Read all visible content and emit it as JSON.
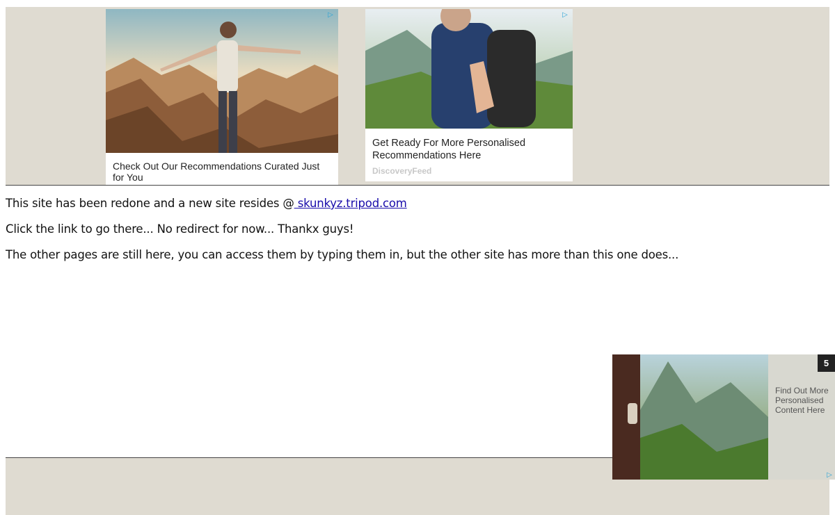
{
  "ads": {
    "ad1": {
      "title": "Check Out Our Recommendations Curated Just for You",
      "adchoice_icon": "adchoices-triangle-icon"
    },
    "ad2": {
      "title": "Get Ready For More Personalised Recommendations Here",
      "source": "DiscoveryFeed",
      "adchoice_icon": "adchoices-triangle-icon"
    },
    "floating": {
      "text": "Find Out More Personalised Content Here",
      "countdown": "5"
    }
  },
  "content": {
    "line1_prefix": "This site has been redone and a new site resides @",
    "link_text": " skunkyz.tripod.com",
    "line2": "Click the link to go there... No redirect for now... Thankx guys!",
    "line3": "The other pages are still here, you can access them by typing them in, but the other site has more than this one does..."
  },
  "colors": {
    "band": "#dfdbd1",
    "link": "#1a0dab",
    "adchoice": "#29a3d6"
  }
}
